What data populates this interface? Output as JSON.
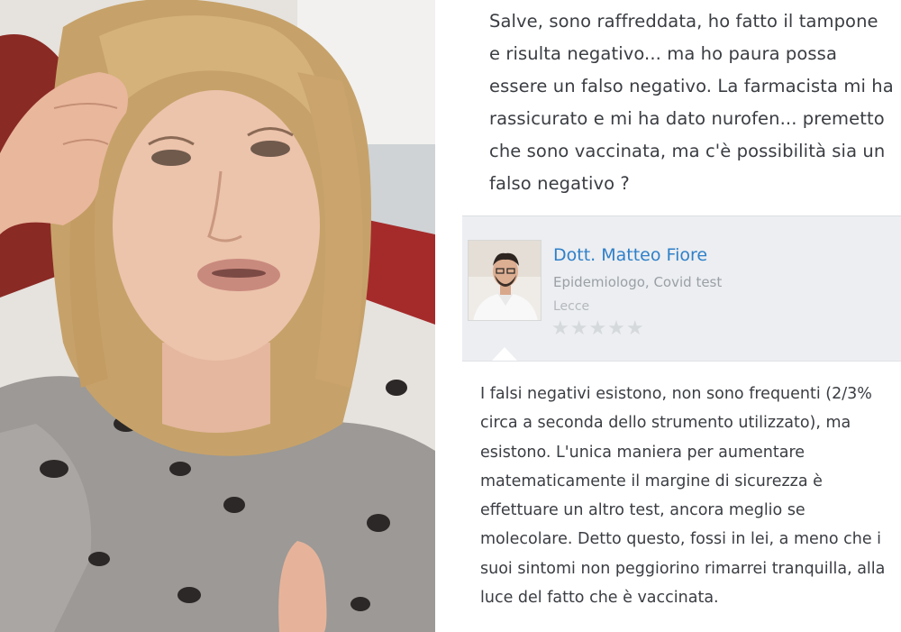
{
  "question": {
    "text": "Salve, sono raffreddata, ho fatto il tampone e risulta negativo... ma ho paura possa essere un falso negativo. La farmacista mi ha rassicurato e mi ha dato nurofen... premetto che sono vaccinata, ma c'è possibilità sia un falso negativo ?"
  },
  "doctor": {
    "name": "Dott. Matteo Fiore",
    "role": "Epidemiologo, Covid test",
    "city": "Lecce",
    "rating_stars": 0,
    "rating_max": 5,
    "stars_display": "★★★★★"
  },
  "answer": {
    "text": "I falsi negativi esistono, non sono frequenti (2/3% circa a seconda dello strumento utilizzato), ma esistono. L'unica maniera per aumentare matematicamente il margine di sicurezza è effettuare un altro test, ancora meglio se molecolare. Detto questo, fossi in lei, a meno che i suoi sintomi non peggiorino rimarrei tranquilla, alla luce del fatto che è vaccinata."
  },
  "colors": {
    "doctor_name": "#2f80c9",
    "star_inactive": "#d6d9dc",
    "panel_bg": "#eceef1"
  }
}
